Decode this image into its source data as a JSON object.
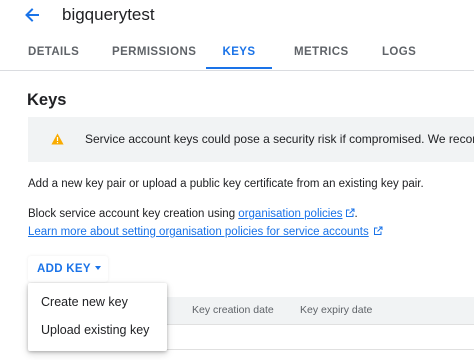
{
  "header": {
    "back_icon": "arrow-back-icon",
    "title": "bigquerytest"
  },
  "tabs": [
    {
      "label": "DETAILS",
      "active": false
    },
    {
      "label": "PERMISSIONS",
      "active": false
    },
    {
      "label": "KEYS",
      "active": true
    },
    {
      "label": "METRICS",
      "active": false
    },
    {
      "label": "LOGS",
      "active": false
    }
  ],
  "section": {
    "title": "Keys"
  },
  "banner": {
    "icon": "warning-icon",
    "text": "Service account keys could pose a security risk if compromised. We recomm"
  },
  "description": {
    "add_text": "Add a new key pair or upload a public key certificate from an existing key pair.",
    "block_prefix": "Block service account key creation using ",
    "block_link": "organisation policies",
    "block_suffix": ".",
    "learn_link": "Learn more about setting organisation policies for service accounts"
  },
  "add_key": {
    "label": "ADD KEY"
  },
  "table": {
    "columns": [
      "Key creation date",
      "Key expiry date"
    ]
  },
  "menu": {
    "items": [
      "Create new key",
      "Upload existing key"
    ]
  },
  "colors": {
    "accent": "#1a73e8",
    "warning": "#f9ab00",
    "banner_bg": "#f1f3f4"
  }
}
